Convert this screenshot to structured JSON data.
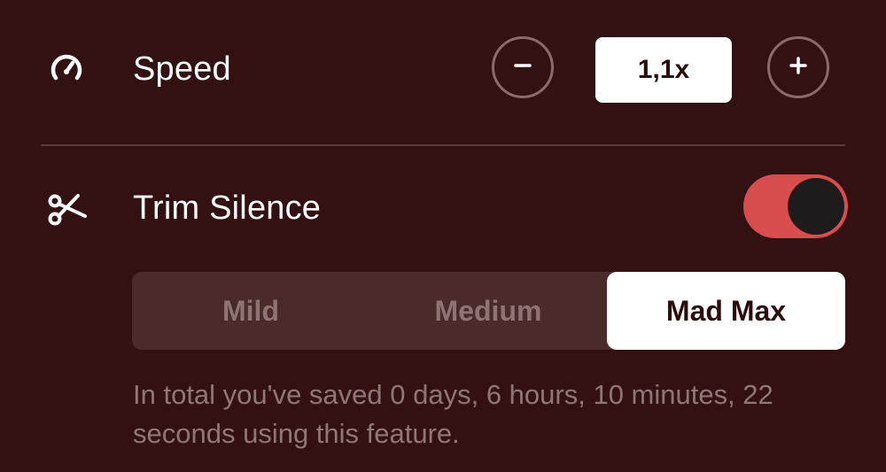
{
  "speed": {
    "label": "Speed",
    "icon": "speedometer-icon",
    "decrease_icon": "minus-icon",
    "value": "1,1x",
    "increase_icon": "plus-icon"
  },
  "trim_silence": {
    "label": "Trim Silence",
    "icon": "scissors-icon",
    "enabled": true,
    "toggle_color": "#d84d4d",
    "options": [
      "Mild",
      "Medium",
      "Mad Max"
    ],
    "selected": "Mad Max",
    "note": "In total you've saved 0 days, 6 hours, 10 minutes, 22 seconds using this feature."
  },
  "colors": {
    "background": "#331112",
    "text": "#ffffff",
    "muted_text": "#8f7677"
  }
}
